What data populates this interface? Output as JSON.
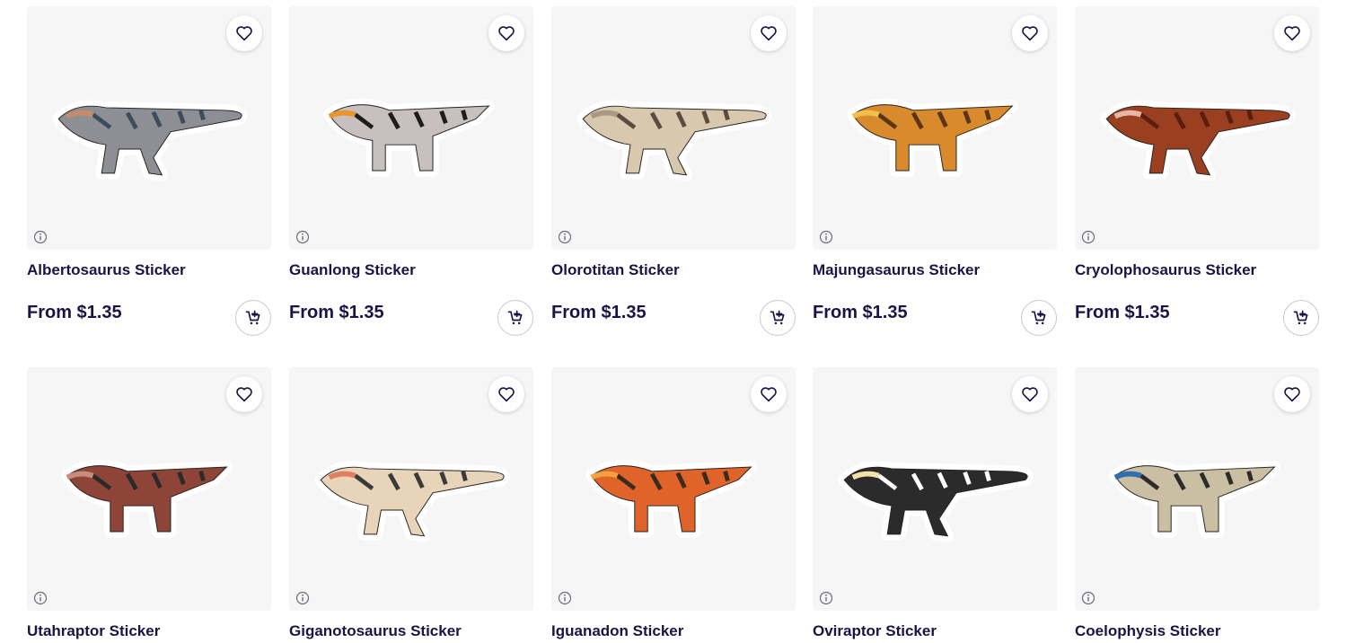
{
  "products": [
    {
      "title": "Albertosaurus Sticker",
      "price": "From $1.35",
      "colors": {
        "body": "#8d8f94",
        "accent": "#c98a6a",
        "stripe": "#3b4d5c"
      }
    },
    {
      "title": "Guanlong Sticker",
      "price": "From $1.35",
      "colors": {
        "body": "#c8c0bf",
        "accent": "#e8962c",
        "stripe": "#1d1d1d"
      }
    },
    {
      "title": "Olorotitan Sticker",
      "price": "From $1.35",
      "colors": {
        "body": "#d8c8ad",
        "accent": "#a99883",
        "stripe": "#5a4c3e"
      }
    },
    {
      "title": "Majungasaurus Sticker",
      "price": "From $1.35",
      "colors": {
        "body": "#d98a2d",
        "accent": "#f0c14a",
        "stripe": "#5b3518"
      }
    },
    {
      "title": "Cryolophosaurus Sticker",
      "price": "From $1.35",
      "colors": {
        "body": "#9a3f1f",
        "accent": "#e6b7a5",
        "stripe": "#5a1e0e"
      }
    }
  ],
  "products_row2": [
    {
      "title": "Utahraptor Sticker",
      "colors": {
        "body": "#8e4538",
        "accent": "#c98c7c",
        "stripe": "#2b2b2b"
      }
    },
    {
      "title": "Giganotosaurus Sticker",
      "colors": {
        "body": "#e8d4b8",
        "accent": "#e08060",
        "stripe": "#3a3a3a"
      }
    },
    {
      "title": "Iguanadon Sticker",
      "colors": {
        "body": "#e0632a",
        "accent": "#f4a040",
        "stripe": "#3b2a1e"
      }
    },
    {
      "title": "Oviraptor Sticker",
      "colors": {
        "body": "#2b2b2b",
        "accent": "#f3e2a6",
        "stripe": "#ffffff"
      }
    },
    {
      "title": "Coelophysis Sticker",
      "colors": {
        "body": "#cbbfa3",
        "accent": "#2f6fb0",
        "stripe": "#2b2b2b"
      }
    }
  ],
  "icons": {
    "favorite": "heart-icon",
    "info": "info-icon",
    "cart": "add-to-cart-icon"
  }
}
